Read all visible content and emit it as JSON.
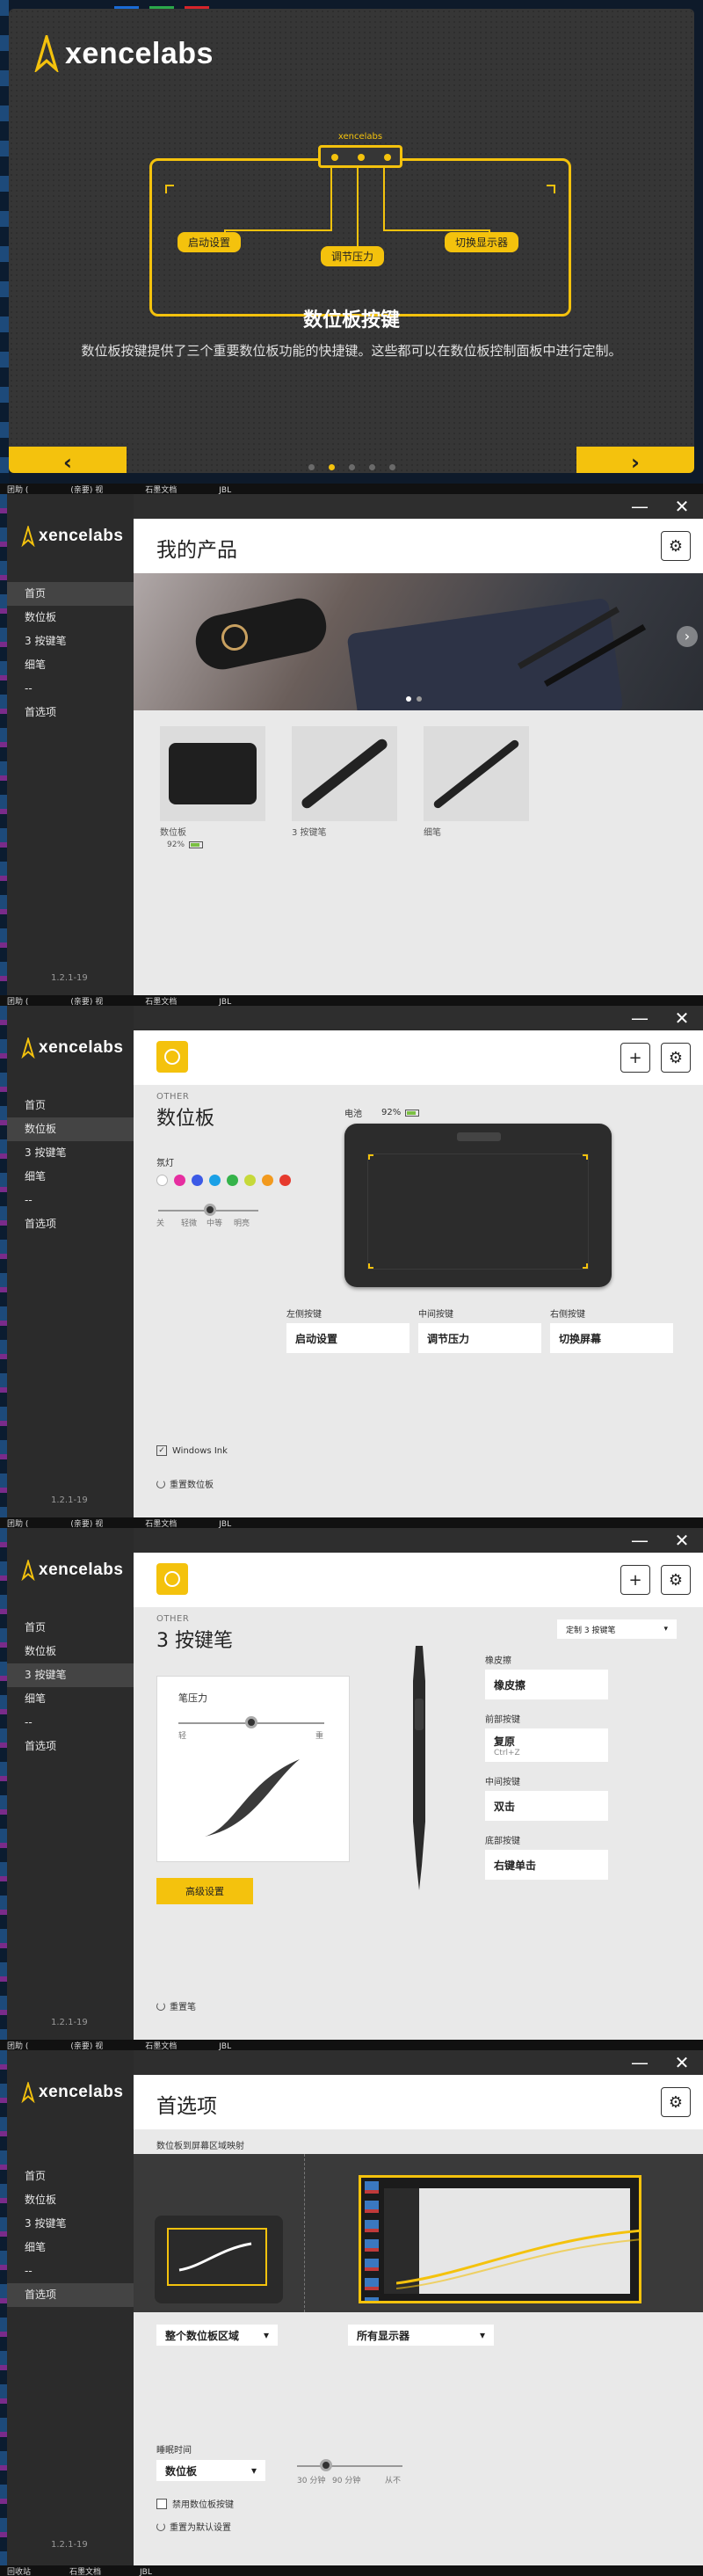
{
  "colors": {
    "accent": "#f4c20d",
    "dark": "#2e2e2e",
    "light_bg": "#e9e9e9"
  },
  "brand": {
    "logo_text": "xencelabs"
  },
  "intro": {
    "tablet_logo": "xencelabs",
    "callouts": [
      "启动设置",
      "调节压力",
      "切换显示器"
    ],
    "headline": "数位板按键",
    "description": "数位板按键提供了三个重要数位板功能的快捷键。这些都可以在数位板控制面板中进行定制。",
    "prev": "‹",
    "next": "›",
    "pages": 5,
    "current_page": 2
  },
  "taskbar": {
    "a": "回收站",
    "b": "石墨文档",
    "c": "JBL"
  },
  "strip": {
    "a": "团助 (",
    "b": "(亲要) 视",
    "c": "石墨文档",
    "d": "JBL"
  },
  "nav": {
    "home": "首页",
    "tablet": "数位板",
    "pen3": "3 按键笔",
    "thin_pen": "细笔",
    "separator": "--",
    "prefs": "首选项"
  },
  "version": "1.2.1-19",
  "window_controls": {
    "minimize": "—",
    "close": "✕"
  },
  "products_page": {
    "title": "我的产品",
    "carousel_prev": "›",
    "products": [
      {
        "name": "数位板",
        "battery": "92%"
      },
      {
        "name": "3 按键笔"
      },
      {
        "name": "细笔"
      }
    ]
  },
  "tablet_page": {
    "category": "OTHER",
    "title": "数位板",
    "battery_label": "电池",
    "battery": "92%",
    "light_label": "氛灯",
    "swatch_colors": [
      "#ffffff",
      "#e62ea0",
      "#3c5ae6",
      "#1aa0e6",
      "#35b34a",
      "#c6d93a",
      "#f29a1e",
      "#e63a2e"
    ],
    "brightness_labels": [
      "关",
      "轻微",
      "中等",
      "明亮"
    ],
    "brightness_level": "中等",
    "buttons": [
      {
        "label": "左侧按键",
        "value": "启动设置"
      },
      {
        "label": "中间按键",
        "value": "调节压力"
      },
      {
        "label": "右侧按键",
        "value": "切换屏幕"
      }
    ],
    "windows_ink": "Windows Ink",
    "reset": "重置数位板",
    "add": "+",
    "settings": "⚙"
  },
  "pen_page": {
    "category": "OTHER",
    "title": "3 按键笔",
    "profile_select": "定制 3 按键笔",
    "pressure_label": "笔压力",
    "pressure_soft": "轻",
    "pressure_firm": "重",
    "pressure_level": 0.5,
    "advanced": "高级设置",
    "reset": "重置笔",
    "buttons": [
      {
        "label": "橡皮擦",
        "value": "橡皮擦",
        "sub": ""
      },
      {
        "label": "前部按键",
        "value": "复原",
        "sub": "Ctrl+Z"
      },
      {
        "label": "中间按键",
        "value": "双击",
        "sub": ""
      },
      {
        "label": "底部按键",
        "value": "右键单击",
        "sub": ""
      }
    ]
  },
  "prefs_page": {
    "title": "首选项",
    "mapping_label": "数位板到屏幕区域映射",
    "tablet_area_select": "整个数位板区域",
    "display_select": "所有显示器",
    "sleep_label": "睡眠时间",
    "sleep_device_select": "数位板",
    "sleep_ticks": [
      "30 分钟",
      "90 分钟",
      "从不"
    ],
    "disable_keys": "禁用数位板按键",
    "reset_defaults": "重置为默认设置"
  }
}
